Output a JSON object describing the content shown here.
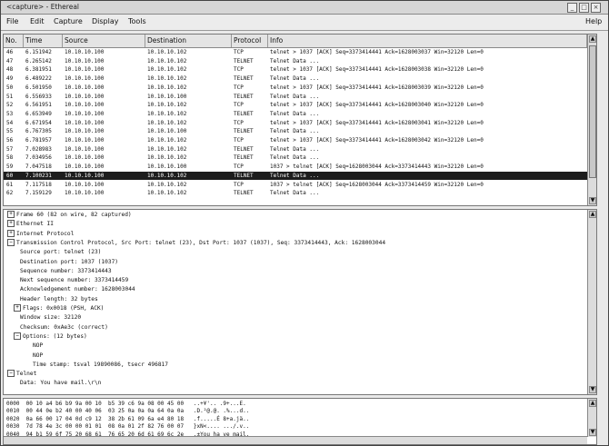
{
  "window": {
    "title": "<capture> - Ethereal"
  },
  "menu": {
    "file": "File",
    "edit": "Edit",
    "capture": "Capture",
    "display": "Display",
    "tools": "Tools",
    "help": "Help"
  },
  "columns": [
    "No.",
    "Time",
    "Source",
    "Destination",
    "Protocol",
    "Info"
  ],
  "packets": [
    {
      "no": "46",
      "time": "6.151942",
      "src": "10.10.10.100",
      "dst": "10.10.10.102",
      "proto": "TCP",
      "info": "telnet > 1037 [ACK] Seq=3373414441 Ack=1628003037 Win=32120 Len=0"
    },
    {
      "no": "47",
      "time": "6.265142",
      "src": "10.10.10.100",
      "dst": "10.10.10.102",
      "proto": "TELNET",
      "info": "Telnet Data ..."
    },
    {
      "no": "48",
      "time": "6.381951",
      "src": "10.10.10.100",
      "dst": "10.10.10.102",
      "proto": "TCP",
      "info": "telnet > 1037 [ACK] Seq=3373414441 Ack=1628003038 Win=32120 Len=0"
    },
    {
      "no": "49",
      "time": "6.489222",
      "src": "10.10.10.100",
      "dst": "10.10.10.102",
      "proto": "TELNET",
      "info": "Telnet Data ..."
    },
    {
      "no": "50",
      "time": "6.501950",
      "src": "10.10.10.100",
      "dst": "10.10.10.102",
      "proto": "TCP",
      "info": "telnet > 1037 [ACK] Seq=3373414441 Ack=1628003039 Win=32120 Len=0"
    },
    {
      "no": "51",
      "time": "6.556933",
      "src": "10.10.10.100",
      "dst": "10.10.10.100",
      "proto": "TELNET",
      "info": "Telnet Data ..."
    },
    {
      "no": "52",
      "time": "6.561951",
      "src": "10.10.10.100",
      "dst": "10.10.10.102",
      "proto": "TCP",
      "info": "telnet > 1037 [ACK] Seq=3373414441 Ack=1628003040 Win=32120 Len=0"
    },
    {
      "no": "53",
      "time": "6.653949",
      "src": "10.10.10.100",
      "dst": "10.10.10.102",
      "proto": "TELNET",
      "info": "Telnet Data ..."
    },
    {
      "no": "54",
      "time": "6.671954",
      "src": "10.10.10.100",
      "dst": "10.10.10.102",
      "proto": "TCP",
      "info": "telnet > 1037 [ACK] Seq=3373414441 Ack=1628003041 Win=32120 Len=0"
    },
    {
      "no": "55",
      "time": "6.767305",
      "src": "10.10.10.100",
      "dst": "10.10.10.100",
      "proto": "TELNET",
      "info": "Telnet Data ..."
    },
    {
      "no": "56",
      "time": "6.781957",
      "src": "10.10.10.100",
      "dst": "10.10.10.102",
      "proto": "TCP",
      "info": "telnet > 1037 [ACK] Seq=3373414441 Ack=1628003042 Win=32120 Len=0"
    },
    {
      "no": "57",
      "time": "7.028983",
      "src": "10.10.10.100",
      "dst": "10.10.10.102",
      "proto": "TELNET",
      "info": "Telnet Data ..."
    },
    {
      "no": "58",
      "time": "7.034956",
      "src": "10.10.10.100",
      "dst": "10.10.10.102",
      "proto": "TELNET",
      "info": "Telnet Data ..."
    },
    {
      "no": "59",
      "time": "7.047518",
      "src": "10.10.10.100",
      "dst": "10.10.10.100",
      "proto": "TCP",
      "info": "1037 > telnet [ACK] Seq=1628003044 Ack=3373414443 Win=32120 Len=0"
    },
    {
      "no": "60",
      "time": "7.100231",
      "src": "10.10.10.100",
      "dst": "10.10.10.102",
      "proto": "TELNET",
      "info": "Telnet Data ...",
      "selected": true
    },
    {
      "no": "61",
      "time": "7.117518",
      "src": "10.10.10.100",
      "dst": "10.10.10.102",
      "proto": "TCP",
      "info": "1037 > telnet [ACK] Seq=1628003044 Ack=3373414459 Win=32120 Len=0"
    },
    {
      "no": "62",
      "time": "7.159129",
      "src": "10.10.10.100",
      "dst": "10.10.10.102",
      "proto": "TELNET",
      "info": "Telnet Data ..."
    }
  ],
  "details": [
    {
      "text": "Frame 60 (82 on wire, 82 captured)",
      "toggle": "+",
      "indent": 0
    },
    {
      "text": "Ethernet II",
      "toggle": "+",
      "indent": 0
    },
    {
      "text": "Internet Protocol",
      "toggle": "+",
      "indent": 0
    },
    {
      "text": "Transmission Control Protocol, Src Port: telnet (23), Dst Port: 1037 (1037), Seq: 3373414443, Ack: 1628003044",
      "toggle": "-",
      "indent": 0
    },
    {
      "text": "Source port: telnet (23)",
      "toggle": "",
      "indent": 2
    },
    {
      "text": "Destination port: 1037 (1037)",
      "toggle": "",
      "indent": 2
    },
    {
      "text": "Sequence number: 3373414443",
      "toggle": "",
      "indent": 2
    },
    {
      "text": "Next sequence number: 3373414459",
      "toggle": "",
      "indent": 2
    },
    {
      "text": "Acknowledgement number: 1628003044",
      "toggle": "",
      "indent": 2
    },
    {
      "text": "Header length: 32 bytes",
      "toggle": "",
      "indent": 2
    },
    {
      "text": "Flags: 0x0018 (PSH, ACK)",
      "toggle": "+",
      "indent": 1
    },
    {
      "text": "Window size: 32120",
      "toggle": "",
      "indent": 2
    },
    {
      "text": "Checksum: 0xAe3c (correct)",
      "toggle": "",
      "indent": 2
    },
    {
      "text": "Options: (12 bytes)",
      "toggle": "-",
      "indent": 1
    },
    {
      "text": "NOP",
      "toggle": "",
      "indent": 4
    },
    {
      "text": "NOP",
      "toggle": "",
      "indent": 4
    },
    {
      "text": "Time stamp: tsval 19890086, tsecr 496817",
      "toggle": "",
      "indent": 4
    },
    {
      "text": "Telnet",
      "toggle": "-",
      "indent": 0
    },
    {
      "text": "Data: You have mail.\\r\\n",
      "toggle": "",
      "indent": 2
    }
  ],
  "hexdump": [
    "0000  00 10 a4 b6 b9 9a 00 10  b5 39 c6 9a 08 00 45 00   ..+¥'.. .9+...E.",
    "0010  00 44 0e b2 40 00 40 06  03 25 0a 0a 0a 64 0a 0a   .D.²@.@. .%...d..",
    "0020  0a 66 00 17 04 0d c9 12  38 2b 61 09 6a e4 80 18   .f.....É 8+a.jä..",
    "0030  7d 78 4e 3c 00 00 01 01  08 0a 01 2f 82 76 00 07   }xN<.... .../.v..",
    "0040  94 b1 59 6f 75 20 68 61  76 65 20 6d 61 69 6c 2e   .±You ha ve mail."
  ]
}
